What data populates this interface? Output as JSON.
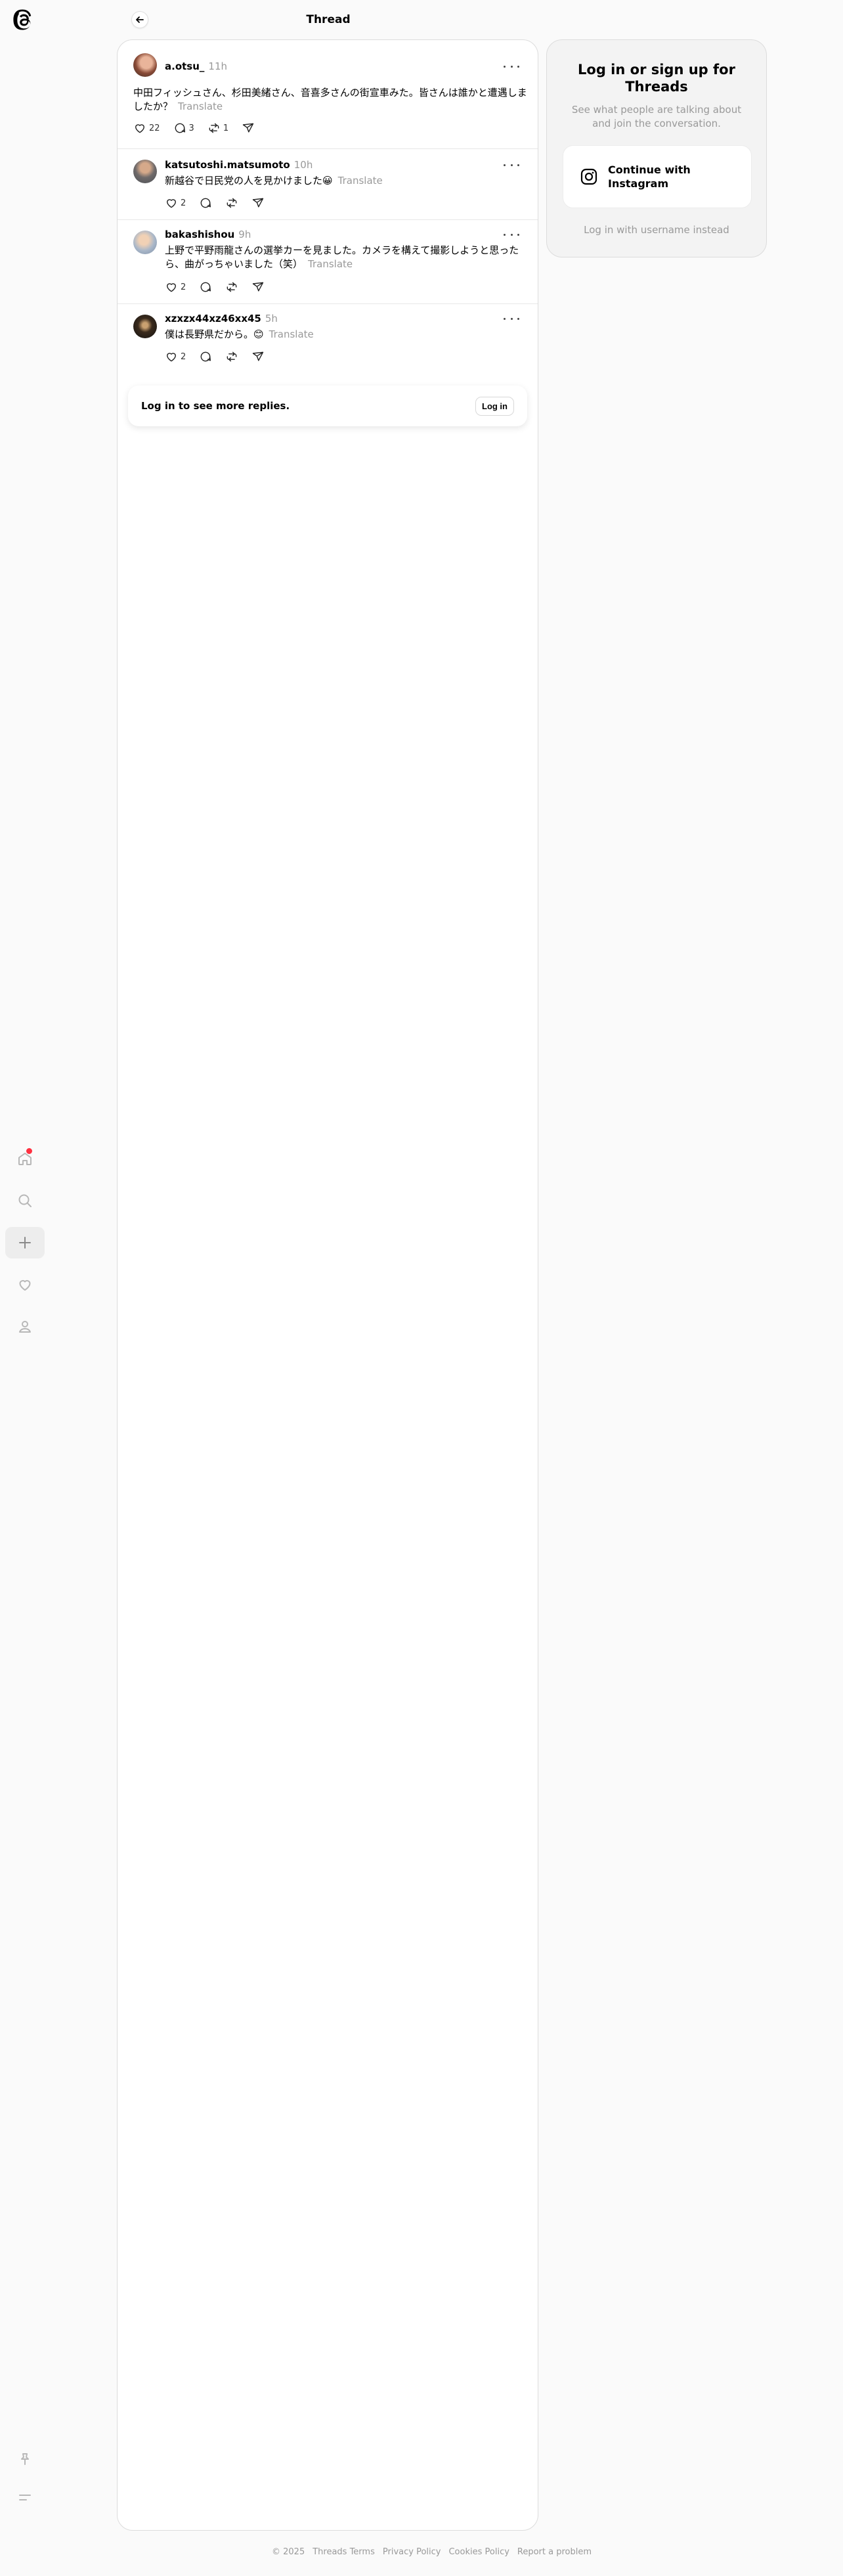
{
  "app": {
    "title": "Thread",
    "accent_notif": "#ff3040"
  },
  "nav": [
    {
      "icon": "home-icon",
      "active": false
    },
    {
      "icon": "search-icon",
      "active": false
    },
    {
      "icon": "plus-icon",
      "active": true
    },
    {
      "icon": "heart-icon",
      "active": false
    },
    {
      "icon": "profile-icon",
      "active": false
    }
  ],
  "posts": [
    {
      "username": "a.otsu_",
      "time": "11h",
      "text": "中田フィッシュさん、杉田美緒さん、音喜多さんの街宣車みた。皆さんは誰かと遭遇しましたか？",
      "translate": "Translate",
      "likes": "22",
      "replies": "3",
      "reposts": "1"
    },
    {
      "username": "katsutoshi.matsumoto",
      "time": "10h",
      "text": "新越谷で日民党の人を見かけました😀",
      "translate": "Translate",
      "likes": "2",
      "replies": "",
      "reposts": ""
    },
    {
      "username": "bakashishou",
      "time": "9h",
      "text": "上野で平野雨龍さんの選挙カーを見ました。カメラを構えて撮影しようと思ったら、曲がっちゃいました（笑）",
      "translate": "Translate",
      "likes": "2",
      "replies": "",
      "reposts": ""
    },
    {
      "username": "xzxzx44xz46xx45",
      "time": "5h",
      "text": "僕は長野県だから。😊",
      "translate": "Translate",
      "likes": "2",
      "replies": "",
      "reposts": ""
    }
  ],
  "login_prompt": {
    "label": "Log in to see more replies.",
    "button": "Log in"
  },
  "side": {
    "title": "Log in or sign up for Threads",
    "subtitle": "See what people are talking about and join the conversation.",
    "instagram_button": "Continue with Instagram",
    "alt_login": "Log in with username instead"
  },
  "footer": [
    "© 2025",
    "Threads Terms",
    "Privacy Policy",
    "Cookies Policy",
    "Report a problem"
  ]
}
